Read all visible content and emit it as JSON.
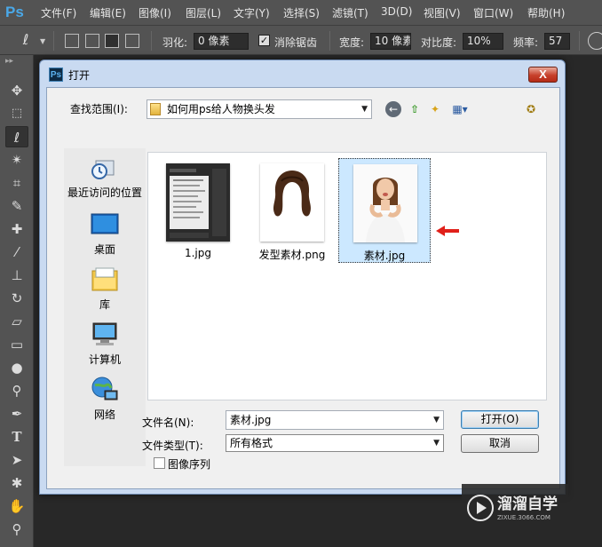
{
  "app": {
    "logo": "Ps"
  },
  "menu": [
    "文件(F)",
    "编辑(E)",
    "图像(I)",
    "图层(L)",
    "文字(Y)",
    "选择(S)",
    "滤镜(T)",
    "3D(D)",
    "视图(V)",
    "窗口(W)",
    "帮助(H)"
  ],
  "options": {
    "feather_label": "羽化:",
    "feather_value": "0 像素",
    "antialias_label": "消除锯齿",
    "width_label": "宽度:",
    "width_value": "10 像素",
    "contrast_label": "对比度:",
    "contrast_value": "10%",
    "frequency_label": "频率:",
    "frequency_value": "57"
  },
  "dialog": {
    "icon": "Ps",
    "title": "打开",
    "close": "X",
    "look_in_label": "查找范围(I):",
    "look_in_value": "如何用ps给人物换头发",
    "places": [
      {
        "label": "最近访问的位置",
        "icon": "recent-places-icon"
      },
      {
        "label": "桌面",
        "icon": "desktop-icon"
      },
      {
        "label": "库",
        "icon": "libraries-icon"
      },
      {
        "label": "计算机",
        "icon": "computer-icon"
      },
      {
        "label": "网络",
        "icon": "network-icon"
      }
    ],
    "files": [
      {
        "name": "1.jpg",
        "selected": false
      },
      {
        "name": "发型素材.png",
        "selected": false
      },
      {
        "name": "素材.jpg",
        "selected": true
      }
    ],
    "filename_label": "文件名(N):",
    "filename_value": "素材.jpg",
    "filetype_label": "文件类型(T):",
    "filetype_value": "所有格式",
    "open_button": "打开(O)",
    "cancel_button": "取消",
    "image_sequence_label": "图像序列",
    "annotation_color": "#e0201a"
  },
  "watermark": {
    "title": "溜溜自学",
    "subtitle": "ZIXUE.3066.COM"
  }
}
